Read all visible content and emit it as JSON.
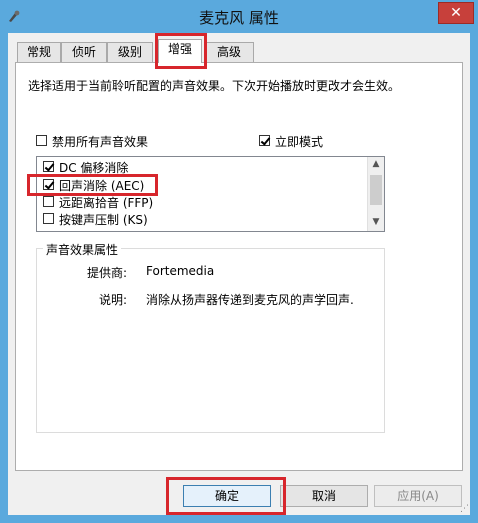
{
  "window": {
    "title": "麦克风 属性",
    "close_glyph": "✕"
  },
  "tabs": [
    {
      "label": "常规",
      "active": false
    },
    {
      "label": "侦听",
      "active": false
    },
    {
      "label": "级别",
      "active": false
    },
    {
      "label": "增强",
      "active": true
    },
    {
      "label": "高级",
      "active": false
    }
  ],
  "description": "选择适用于当前聆听配置的声音效果。下次开始播放时更改才会生效。",
  "options": {
    "disable_all": {
      "label": "禁用所有声音效果",
      "checked": false
    },
    "immediate_mode": {
      "label": "立即模式",
      "checked": true
    }
  },
  "effects": [
    {
      "label": "DC 偏移消除",
      "checked": true
    },
    {
      "label": "回声消除 (AEC)",
      "checked": true
    },
    {
      "label": "远距离拾音 (FFP)",
      "checked": false
    },
    {
      "label": "按键声压制 (KS)",
      "checked": false
    }
  ],
  "properties": {
    "group_title": "声音效果属性",
    "provider_label": "提供商:",
    "provider_value": "Fortemedia",
    "description_label": "说明:",
    "description_value": "消除从扬声器传递到麦克风的声学回声."
  },
  "buttons": {
    "ok": "确定",
    "cancel": "取消",
    "apply": "应用(A)"
  },
  "icons": {
    "scroll_up": "▲",
    "scroll_down": "▼",
    "grip": "⋰"
  },
  "colors": {
    "highlight": "#d7262c",
    "frame": "#5aa9dd"
  }
}
